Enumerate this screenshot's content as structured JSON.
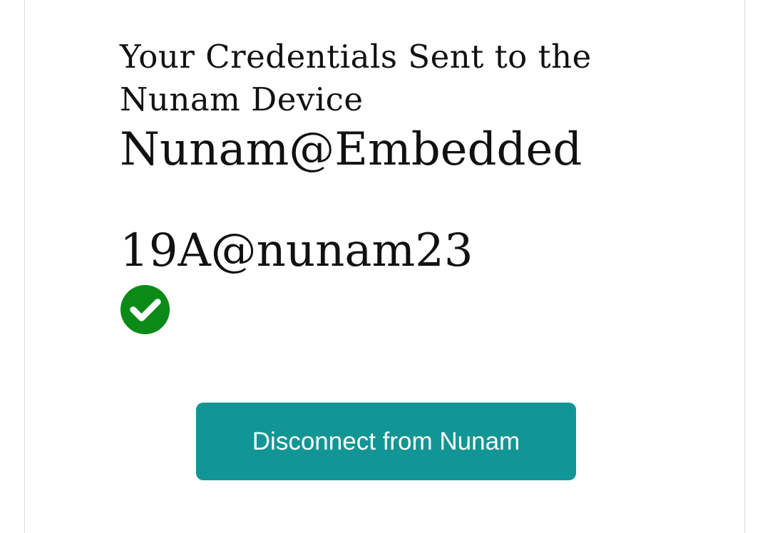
{
  "status": {
    "heading": "Your Credentials Sent to the Nunam Device",
    "network_name": "Nunam@Embedded",
    "network_password": "19A@nunam23",
    "success_icon": "check-circle-icon",
    "success_color": "#0b8a17"
  },
  "actions": {
    "disconnect_label": "Disconnect from Nunam",
    "disconnect_color": "#129695"
  }
}
